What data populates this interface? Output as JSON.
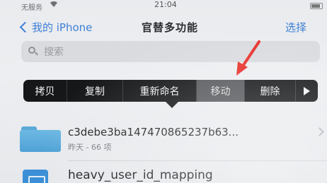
{
  "status_bar": {
    "carrier": "无服务",
    "time": "21:04"
  },
  "nav": {
    "back_label": "我的 iPhone",
    "title": "官替多功能",
    "select_label": "选择"
  },
  "search": {
    "placeholder": "搜索"
  },
  "context_menu": {
    "items": [
      {
        "label": "拷贝"
      },
      {
        "label": "复制"
      },
      {
        "label": "重新命名"
      },
      {
        "label": "移动"
      },
      {
        "label": "删除"
      }
    ],
    "highlighted": "移动"
  },
  "files": [
    {
      "name": "c3debe3ba147470865237b63...",
      "meta": "昨天 - 66 项",
      "icon": "folder-icon"
    },
    {
      "name": "heavy_user_id_mapping",
      "icon": "document-icon"
    }
  ],
  "colors": {
    "accent": "#3d7fd6",
    "menu_bg": "#161719",
    "annotation": "#e8312b"
  }
}
